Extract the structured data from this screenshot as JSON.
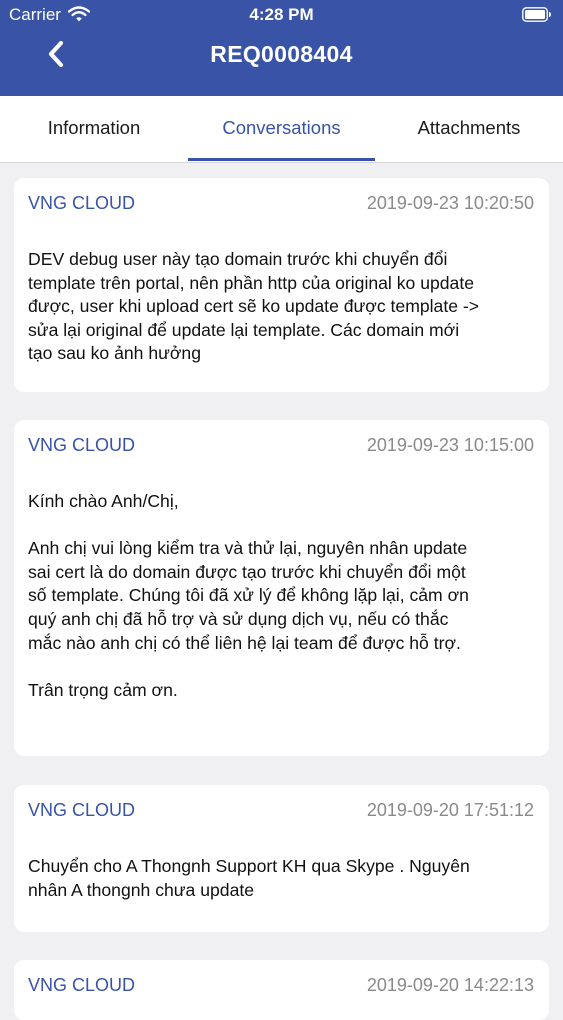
{
  "status_bar": {
    "carrier": "Carrier",
    "time": "4:28 PM"
  },
  "nav": {
    "title": "REQ0008404",
    "back_icon": "chevron-left-icon"
  },
  "tabs": [
    {
      "label": "Information",
      "active": false
    },
    {
      "label": "Conversations",
      "active": true
    },
    {
      "label": "Attachments",
      "active": false
    }
  ],
  "colors": {
    "brand": "#3953a7",
    "background": "#f0f0f2",
    "card": "#ffffff",
    "muted_text": "#8a8a8a"
  },
  "conversations": [
    {
      "author": "VNG CLOUD",
      "date": "2019-09-23 10:20:50",
      "lines": [
        "DEV debug user này tạo domain trước khi chuyển đổi",
        "template trên portal, nên phần http của original ko update",
        "được, user khi upload cert sẽ ko update được template ->",
        "sửa lại original để update lại template. Các domain mới",
        "tạo sau ko ảnh hưởng"
      ]
    },
    {
      "author": "VNG CLOUD",
      "date": "2019-09-23 10:15:00",
      "greeting": "Kính chào Anh/Chị,",
      "lines": [
        "Anh chị vui lòng kiểm tra và thử lại, nguyên nhân update",
        "sai cert là do domain được tạo trước khi chuyển đổi một",
        "số template. Chúng tôi đã xử lý để không lặp lại, cảm ơn",
        "quý anh chị đã hỗ trợ và sử dụng dịch vụ, nếu có thắc",
        "mắc nào anh chị có thể liên hệ lại team để được hỗ trợ."
      ],
      "closing": "Trân trọng cảm ơn."
    },
    {
      "author": "VNG CLOUD",
      "date": "2019-09-20 17:51:12",
      "lines": [
        "Chuyển cho A Thongnh Support KH qua Skype . Nguyên",
        "nhân A thongnh chưa update"
      ]
    },
    {
      "author": "VNG CLOUD",
      "date": "2019-09-20 14:22:13"
    }
  ]
}
